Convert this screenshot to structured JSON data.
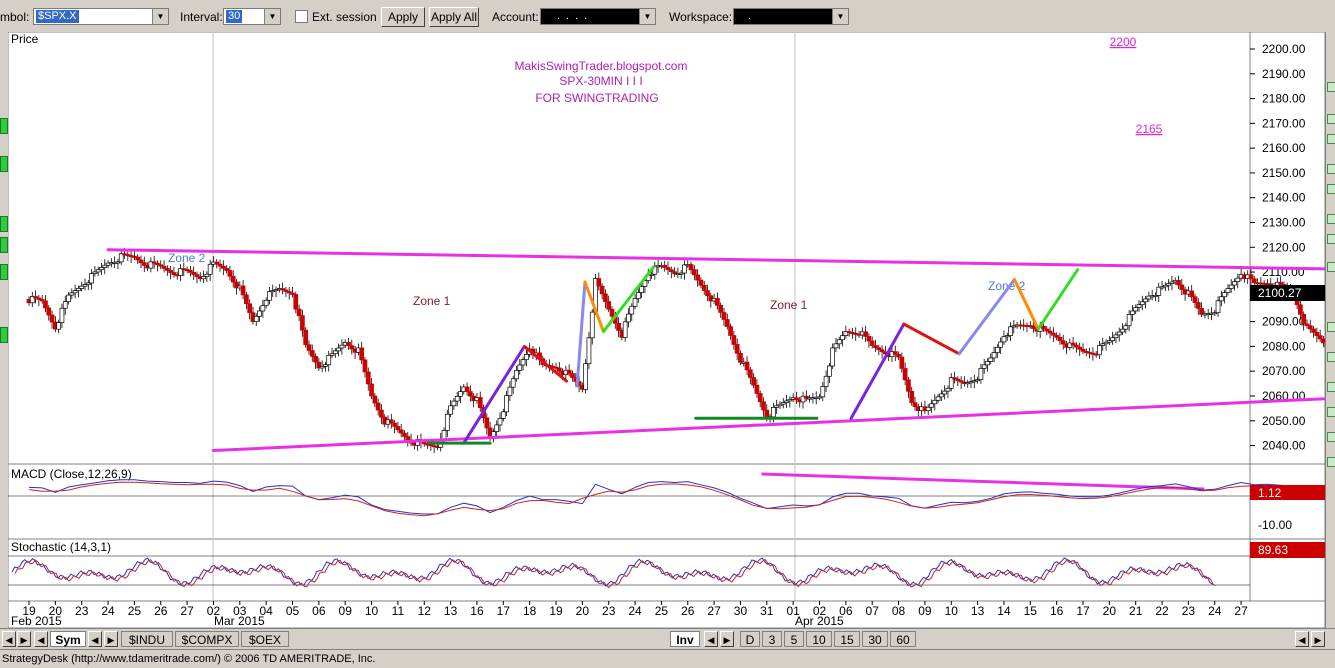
{
  "toolbar": {
    "symbol_label": "mbol:",
    "symbol_value": "$SPX.X",
    "interval_label": "Interval:",
    "interval_value": "30",
    "ext_session_label": "Ext. session",
    "apply_label": "Apply",
    "apply_all_label": "Apply All",
    "account_label": "Account:",
    "account_value": "....",
    "workspace_label": "Workspace:",
    "workspace_value": "."
  },
  "price_panel": {
    "title": "Price",
    "annotation_line1": "MakisSwingTrader.blogspot.com",
    "annotation_line2": "SPX-30MIN  I I I",
    "annotation_line3": "FOR SWINGTRADING",
    "zone_labels": [
      "Zone 2",
      "Zone 1",
      "Zone 1",
      "Zone 2"
    ],
    "target_labels": [
      "2200",
      "2165"
    ],
    "current_price": "2100.27",
    "y_ticks": [
      "2200.00",
      "2190.00",
      "2180.00",
      "2170.00",
      "2160.00",
      "2150.00",
      "2140.00",
      "2130.00",
      "2120.00",
      "2110.00",
      "2100.00",
      "2090.00",
      "2080.00",
      "2070.00",
      "2060.00",
      "2050.00",
      "2040.00"
    ]
  },
  "macd_panel": {
    "title": "MACD (Close,12,26,9)",
    "current_value": "1.12",
    "tick_label": "-10.00"
  },
  "stoch_panel": {
    "title": "Stochastic (14,3,1)",
    "current_value": "89.63"
  },
  "x_axis": {
    "day_labels": [
      "19",
      "20",
      "23",
      "24",
      "25",
      "26",
      "27",
      "02",
      "03",
      "04",
      "05",
      "06",
      "09",
      "10",
      "11",
      "12",
      "13",
      "16",
      "17",
      "18",
      "19",
      "20",
      "23",
      "24",
      "25",
      "26",
      "27",
      "30",
      "31",
      "01",
      "02",
      "06",
      "07",
      "08",
      "09",
      "10",
      "13",
      "14",
      "15",
      "16",
      "17",
      "20",
      "21",
      "22",
      "23",
      "24",
      "27"
    ],
    "month_labels": [
      "Feb 2015",
      "Mar 2015",
      "Apr 2015"
    ]
  },
  "bottom_bar": {
    "sym_tab": "Sym",
    "symbol_tabs": [
      "$INDU",
      "$COMPX",
      "$OEX"
    ],
    "inv_tab": "Inv",
    "interval_tabs": [
      "D",
      "3",
      "5",
      "10",
      "15",
      "30",
      "60"
    ]
  },
  "status_bar": {
    "text": "StrategyDesk (http://www.tdameritrade.com/) © 2006 TD AMERITRADE, Inc."
  },
  "chart_data": [
    {
      "type": "candlestick",
      "title": "Price",
      "ylim": [
        2033,
        2207
      ],
      "y_ticks": [
        2200,
        2190,
        2180,
        2170,
        2160,
        2150,
        2140,
        2130,
        2120,
        2110,
        2100,
        2090,
        2080,
        2070,
        2060,
        2050,
        2040
      ],
      "x_categories": [
        "19",
        "20",
        "23",
        "24",
        "25",
        "26",
        "27",
        "02",
        "03",
        "04",
        "05",
        "06",
        "09",
        "10",
        "11",
        "12",
        "13",
        "16",
        "17",
        "18",
        "19",
        "20",
        "23",
        "24",
        "25",
        "26",
        "27",
        "30",
        "31",
        "01",
        "02",
        "06",
        "07",
        "08",
        "09",
        "10",
        "13",
        "14",
        "15",
        "16",
        "17",
        "20",
        "21",
        "22",
        "23",
        "24",
        "27"
      ],
      "months": [
        "Feb 2015",
        "Mar 2015",
        "Apr 2015"
      ],
      "close_path": [
        [
          0,
          2099
        ],
        [
          0.5,
          2098
        ],
        [
          1,
          2088
        ],
        [
          1.5,
          2100
        ],
        [
          2,
          2105
        ],
        [
          2.5,
          2109
        ],
        [
          3,
          2114
        ],
        [
          3.5,
          2116
        ],
        [
          4,
          2116
        ],
        [
          4.5,
          2113
        ],
        [
          5,
          2112
        ],
        [
          5.5,
          2110
        ],
        [
          6,
          2110
        ],
        [
          6.5,
          2108
        ],
        [
          7,
          2113
        ],
        [
          7.5,
          2111
        ],
        [
          8,
          2103
        ],
        [
          8.5,
          2090
        ],
        [
          9,
          2100
        ],
        [
          9.5,
          2103
        ],
        [
          10,
          2102
        ],
        [
          10.5,
          2080
        ],
        [
          11,
          2072
        ],
        [
          11.5,
          2076
        ],
        [
          12,
          2082
        ],
        [
          12.5,
          2078
        ],
        [
          13,
          2060
        ],
        [
          13.5,
          2050
        ],
        [
          14,
          2046
        ],
        [
          14.5,
          2042
        ],
        [
          15,
          2040
        ],
        [
          15.5,
          2040
        ],
        [
          16,
          2055
        ],
        [
          16.5,
          2064
        ],
        [
          17,
          2058
        ],
        [
          17.5,
          2043
        ],
        [
          18,
          2055
        ],
        [
          18.5,
          2070
        ],
        [
          19,
          2080
        ],
        [
          19.5,
          2072
        ],
        [
          20,
          2072
        ],
        [
          20.5,
          2068
        ],
        [
          21,
          2063
        ],
        [
          21.5,
          2106
        ],
        [
          22,
          2095
        ],
        [
          22.5,
          2085
        ],
        [
          23,
          2099
        ],
        [
          23.5,
          2110
        ],
        [
          24,
          2112
        ],
        [
          24.5,
          2110
        ],
        [
          25,
          2112
        ],
        [
          25.5,
          2105
        ],
        [
          26,
          2098
        ],
        [
          26.5,
          2088
        ],
        [
          27,
          2075
        ],
        [
          27.5,
          2064
        ],
        [
          28,
          2052
        ],
        [
          28.5,
          2056
        ],
        [
          29,
          2060
        ],
        [
          29.5,
          2058
        ],
        [
          30,
          2060
        ],
        [
          30.5,
          2078
        ],
        [
          31,
          2086
        ],
        [
          31.5,
          2086
        ],
        [
          32,
          2080
        ],
        [
          32.5,
          2078
        ],
        [
          33,
          2075
        ],
        [
          33.5,
          2058
        ],
        [
          34,
          2053
        ],
        [
          34.5,
          2060
        ],
        [
          35,
          2066
        ],
        [
          35.5,
          2065
        ],
        [
          36,
          2068
        ],
        [
          36.5,
          2075
        ],
        [
          37,
          2085
        ],
        [
          37.5,
          2088
        ],
        [
          38,
          2089
        ],
        [
          38.5,
          2086
        ],
        [
          39,
          2084
        ],
        [
          39.5,
          2080
        ],
        [
          40,
          2078
        ],
        [
          40.5,
          2078
        ],
        [
          41,
          2082
        ],
        [
          41.5,
          2088
        ],
        [
          42,
          2095
        ],
        [
          42.5,
          2101
        ],
        [
          43,
          2103
        ],
        [
          43.5,
          2107
        ],
        [
          44,
          2101
        ],
        [
          44.5,
          2093
        ],
        [
          45,
          2095
        ],
        [
          45.5,
          2103
        ],
        [
          46,
          2110
        ],
        [
          46.5,
          2105
        ],
        [
          47,
          2106
        ],
        [
          47.5,
          2104
        ],
        [
          48,
          2101
        ],
        [
          48.5,
          2087
        ],
        [
          49,
          2083
        ],
        [
          49.5,
          2078
        ],
        [
          50,
          2076
        ],
        [
          50.5,
          2090
        ],
        [
          51,
          2101
        ],
        [
          51.5,
          2103
        ],
        [
          52,
          2101
        ],
        [
          52.5,
          2100
        ]
      ],
      "annotations": {
        "targets": [
          2200,
          2165
        ],
        "resistance_line": [
          [
            3,
            2119
          ],
          [
            57,
            2110
          ]
        ],
        "support_line": [
          [
            7,
            2038
          ],
          [
            57.5,
            2063
          ]
        ]
      }
    },
    {
      "type": "line",
      "title": "MACD (Close,12,26,9)",
      "series": [
        {
          "name": "MACD"
        },
        {
          "name": "Signal"
        }
      ],
      "last_value": 1.12,
      "tick": -10.0
    },
    {
      "type": "line",
      "title": "Stochastic (14,3,1)",
      "last_value": 89.63
    }
  ],
  "colors": {
    "bull_candle": "#ffffff",
    "bear_candle": "#cc0000",
    "trendline": "#e830e8",
    "annotation_text": "#b020b0",
    "zone_blue": "#4a7ad8",
    "zone_red": "#8b1a1a",
    "up_blue": "#7722dd",
    "down_red": "#dd1111",
    "orange": "#ff8c00",
    "green": "#33dd22",
    "support_green": "#118822"
  }
}
